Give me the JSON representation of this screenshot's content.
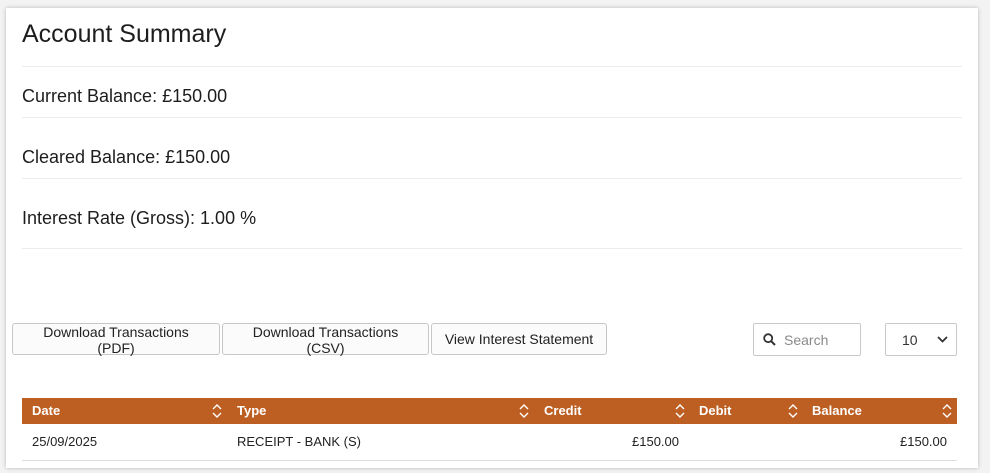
{
  "summary": {
    "title": "Account Summary",
    "current_balance": "Current Balance: £150.00",
    "cleared_balance": "Cleared Balance: £150.00",
    "interest_rate": "Interest Rate (Gross): 1.00 %"
  },
  "toolbar": {
    "download_pdf": "Download Transactions (PDF)",
    "download_csv": "Download Transactions (CSV)",
    "view_interest": "View Interest Statement",
    "search_placeholder": "Search",
    "page_size": "10"
  },
  "table": {
    "columns": [
      "Date",
      "Type",
      "Credit",
      "Debit",
      "Balance"
    ],
    "rows": [
      {
        "date": "25/09/2025",
        "type": "RECEIPT - BANK (S)",
        "credit": "£150.00",
        "debit": "",
        "balance": "£150.00"
      }
    ]
  },
  "colors": {
    "header_bg": "#bd5f22",
    "header_text": "#ffffff"
  },
  "icons": {
    "search": "search-icon",
    "dropdown": "chevron-down-icon",
    "sort": "sort-icon"
  }
}
